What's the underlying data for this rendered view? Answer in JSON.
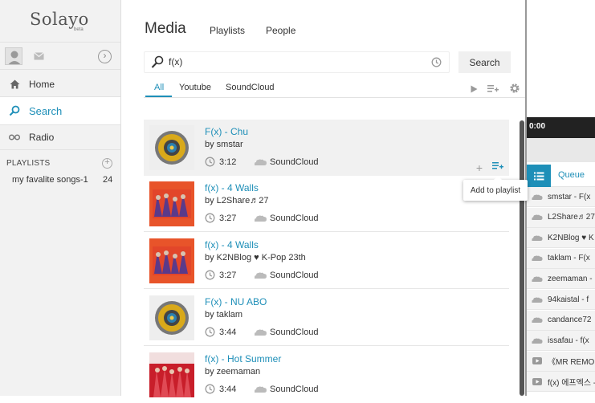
{
  "app": {
    "name": "Solayo",
    "badge": "beta"
  },
  "sidebar": {
    "nav": [
      {
        "label": "Home",
        "icon": "home-icon"
      },
      {
        "label": "Search",
        "icon": "search-icon",
        "active": true
      },
      {
        "label": "Radio",
        "icon": "radio-icon"
      }
    ],
    "playlists_header": "PLAYLISTS",
    "playlists": [
      {
        "name": "my favalite songs-1",
        "count": "24"
      }
    ]
  },
  "main": {
    "title": "Media",
    "tabs": [
      "Playlists",
      "People"
    ],
    "search": {
      "value": "f(x)",
      "button": "Search"
    },
    "filters": [
      "All",
      "Youtube",
      "SoundCloud"
    ],
    "active_filter": "All",
    "tooltip": "Add to playlist",
    "results": [
      {
        "title": "F(x) - Chu",
        "by": "by smstar",
        "duration": "3:12",
        "source": "SoundCloud"
      },
      {
        "title": "f(x) - 4 Walls",
        "by": "by L2Share♬27",
        "duration": "3:27",
        "source": "SoundCloud"
      },
      {
        "title": "f(x) - 4 Walls",
        "by": "by K2NBlog ♥ K-Pop 23th",
        "duration": "3:27",
        "source": "SoundCloud"
      },
      {
        "title": "F(x) - NU ABO",
        "by": "by taklam",
        "duration": "3:44",
        "source": "SoundCloud"
      },
      {
        "title": "f(x) - Hot Summer",
        "by": "by zeemaman",
        "duration": "3:44",
        "source": "SoundCloud"
      }
    ]
  },
  "player": {
    "time": "0:00",
    "queue_label": "Queue",
    "queue": [
      {
        "text": "smstar - F(x",
        "source": "soundcloud"
      },
      {
        "text": "L2Share♬27",
        "source": "soundcloud"
      },
      {
        "text": "K2NBlog ♥ K",
        "source": "soundcloud"
      },
      {
        "text": "taklam - F(x",
        "source": "soundcloud"
      },
      {
        "text": "zeemaman -",
        "source": "soundcloud"
      },
      {
        "text": "94kaistal - f",
        "source": "soundcloud"
      },
      {
        "text": "candance72",
        "source": "soundcloud"
      },
      {
        "text": "issafau - f(x",
        "source": "soundcloud"
      },
      {
        "text": "《MR REMO",
        "source": "youtube"
      },
      {
        "text": "f(x) 에프엑스 -",
        "source": "youtube"
      }
    ]
  },
  "colors": {
    "accent": "#1e8fb8",
    "sidebar_bg": "#f2f2f2",
    "hover_row": "#f1f1f1"
  }
}
